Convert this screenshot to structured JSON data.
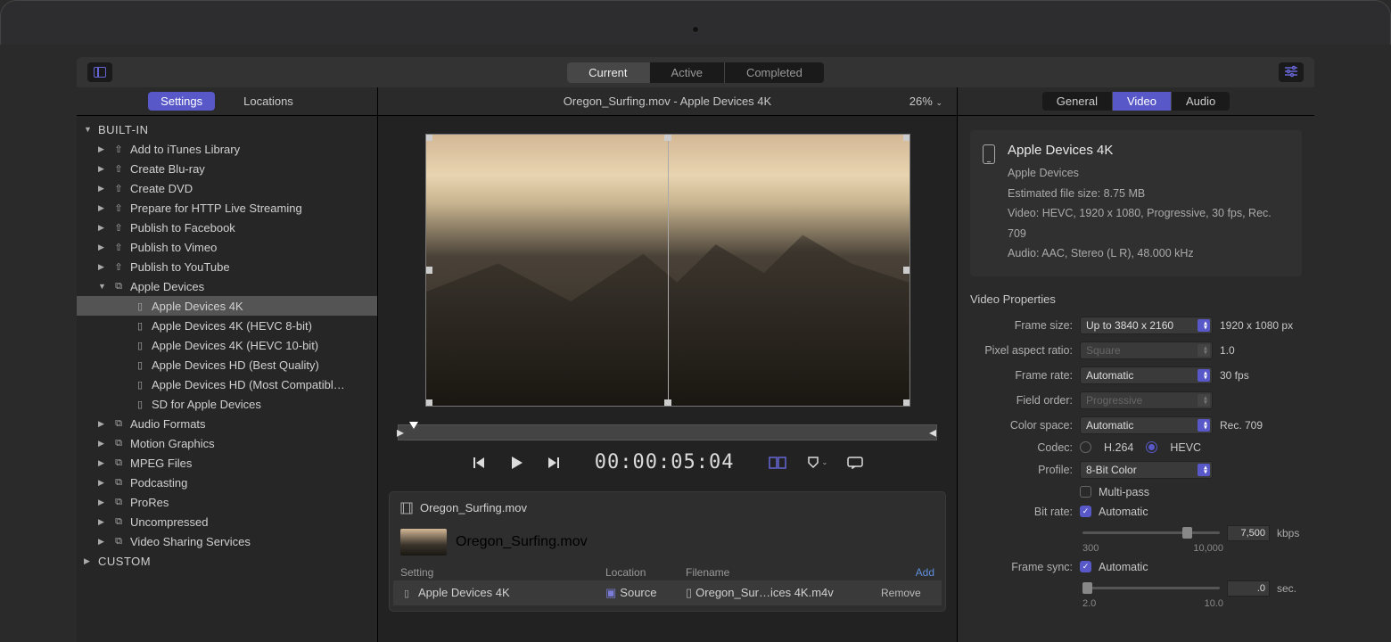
{
  "toolbar": {
    "tabs": {
      "current": "Current",
      "active": "Active",
      "completed": "Completed"
    }
  },
  "subheader": {
    "left": {
      "settings": "Settings",
      "locations": "Locations"
    },
    "doc_title": "Oregon_Surfing.mov - Apple Devices 4K",
    "zoom": "26%",
    "right": {
      "general": "General",
      "video": "Video",
      "audio": "Audio"
    }
  },
  "sidebar": {
    "built_in": "BUILT-IN",
    "custom": "CUSTOM",
    "items": {
      "itunes": "Add to iTunes Library",
      "bluray": "Create Blu-ray",
      "dvd": "Create DVD",
      "http": "Prepare for HTTP Live Streaming",
      "facebook": "Publish to Facebook",
      "vimeo": "Publish to Vimeo",
      "youtube": "Publish to YouTube",
      "apple": "Apple Devices",
      "apple_4k": "Apple Devices 4K",
      "apple_4k_8": "Apple Devices 4K (HEVC 8-bit)",
      "apple_4k_10": "Apple Devices 4K (HEVC 10-bit)",
      "apple_hd_best": "Apple Devices HD (Best Quality)",
      "apple_hd_compat": "Apple Devices HD (Most Compatibl…",
      "apple_sd": "SD for Apple Devices",
      "audio_fmt": "Audio Formats",
      "motion": "Motion Graphics",
      "mpeg": "MPEG Files",
      "podcast": "Podcasting",
      "prores": "ProRes",
      "uncomp": "Uncompressed",
      "sharing": "Video Sharing Services"
    }
  },
  "playback": {
    "timecode": "00:00:05:04"
  },
  "batch": {
    "file": "Oregon_Surfing.mov",
    "item": "Oregon_Surfing.mov",
    "cols": {
      "setting": "Setting",
      "location": "Location",
      "filename": "Filename",
      "add": "Add"
    },
    "row": {
      "setting": "Apple Devices 4K",
      "location": "Source",
      "filename": "Oregon_Sur…ices 4K.m4v",
      "remove": "Remove"
    }
  },
  "inspector": {
    "title": "Apple Devices 4K",
    "subtitle": "Apple Devices",
    "size": "Estimated file size: 8.75 MB",
    "video_line": "Video: HEVC, 1920 x 1080, Progressive, 30 fps, Rec. 709",
    "audio_line": "Audio: AAC, Stereo (L R), 48.000 kHz",
    "section": "Video Properties",
    "labels": {
      "frame_size": "Frame size:",
      "par": "Pixel aspect ratio:",
      "frame_rate": "Frame rate:",
      "field_order": "Field order:",
      "color_space": "Color space:",
      "codec": "Codec:",
      "profile": "Profile:",
      "multi": "Multi-pass",
      "bitrate": "Bit rate:",
      "frame_sync": "Frame sync:"
    },
    "values": {
      "frame_size": "Up to 3840 x 2160",
      "frame_size_r": "1920 x 1080 px",
      "par": "Square",
      "par_r": "1.0",
      "frame_rate": "Automatic",
      "frame_rate_r": "30 fps",
      "field_order": "Progressive",
      "color_space": "Automatic",
      "color_space_r": "Rec. 709",
      "h264": "H.264",
      "hevc": "HEVC",
      "profile": "8-Bit Color",
      "bitrate_auto": "Automatic",
      "bitrate_val": "7,500",
      "bitrate_unit": "kbps",
      "bitrate_min": "300",
      "bitrate_max": "10,000",
      "sync_auto": "Automatic",
      "sync_val": ".0",
      "sync_unit": "sec.",
      "sync_min": "2.0",
      "sync_max": "10.0"
    }
  }
}
